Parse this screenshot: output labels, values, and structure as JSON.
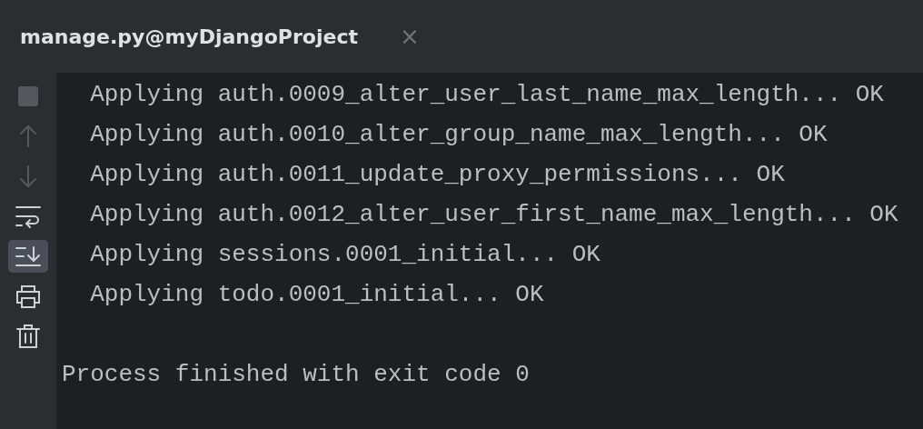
{
  "tab": {
    "title": "manage.py@myDjangoProject",
    "close": "×"
  },
  "toolbar": [
    {
      "kind": "stop",
      "disabled": true,
      "selected": false
    },
    {
      "kind": "up",
      "disabled": true,
      "selected": false
    },
    {
      "kind": "down",
      "disabled": true,
      "selected": false
    },
    {
      "kind": "wrap",
      "disabled": false,
      "selected": false
    },
    {
      "kind": "scroll-end",
      "disabled": false,
      "selected": true
    },
    {
      "kind": "print",
      "disabled": false,
      "selected": false
    },
    {
      "kind": "trash",
      "disabled": false,
      "selected": false
    }
  ],
  "console": {
    "lines": [
      "  Applying auth.0009_alter_user_last_name_max_length... OK",
      "  Applying auth.0010_alter_group_name_max_length... OK",
      "  Applying auth.0011_update_proxy_permissions... OK",
      "  Applying auth.0012_alter_user_first_name_max_length... OK",
      "  Applying sessions.0001_initial... OK",
      "  Applying todo.0001_initial... OK"
    ],
    "exit_message": "Process finished with exit code 0"
  }
}
